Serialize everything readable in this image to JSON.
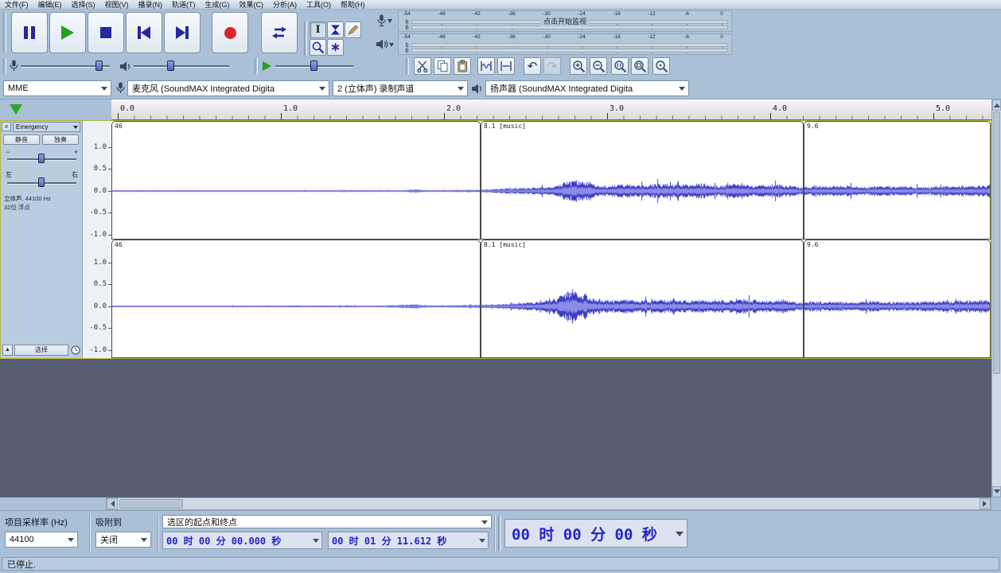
{
  "menu_bar": {
    "items": [
      "文件(F)",
      "编辑(E)",
      "选择(S)",
      "视图(V)",
      "播录(N)",
      "轨道(T)",
      "生成(G)",
      "效果(C)",
      "分析(A)",
      "工具(O)",
      "帮助(H)"
    ]
  },
  "icons": {
    "ibeam": "I",
    "multi": "∗",
    "undo": "↶",
    "redo": "↷",
    "close": "×",
    "collapse": "▲"
  },
  "meters": {
    "scale": [
      "-54",
      "-48",
      "-42",
      "-36",
      "-30",
      "-24",
      "-18",
      "-12",
      "-6",
      "0"
    ],
    "record_overlay": "点击开始监视",
    "left": "左",
    "right": "右"
  },
  "device_bar": {
    "host": "MME",
    "input": "麦克风 (SoundMAX Integrated Digita",
    "channels": "2 (立体声) 录制声道",
    "output": "扬声器 (SoundMAX Integrated Digita"
  },
  "timeline": {
    "labels": [
      "0.0",
      "1.0",
      "2.0",
      "3.0",
      "4.0",
      "5.0"
    ]
  },
  "track": {
    "title": "Emergency",
    "mute": "静音",
    "solo": "独奏",
    "gain_minus": "−",
    "gain_plus": "+",
    "pan_left": "左",
    "pan_right": "右",
    "info1": "立体声, 44100 Hz",
    "info2": "32位 浮点",
    "select": "选择",
    "scale": [
      "1.0",
      "0.5",
      "0.0",
      "-0.5",
      "-1.0"
    ],
    "clips": [
      {
        "label": "46"
      },
      {
        "label": "8.1 [music]"
      },
      {
        "label": "9.6"
      }
    ]
  },
  "waveform": {
    "color": "#3b3bc4",
    "rms_color": "#8c8ce8",
    "ch1": [
      [
        0,
        0.012
      ],
      [
        0.1,
        0.015
      ],
      [
        0.2,
        0.012
      ],
      [
        0.28,
        0.018
      ],
      [
        0.33,
        0.012
      ],
      [
        0.345,
        0.04
      ],
      [
        0.36,
        0.015
      ],
      [
        0.4,
        0.025
      ],
      [
        0.42,
        0.03
      ],
      [
        0.44,
        0.05
      ],
      [
        0.47,
        0.07
      ],
      [
        0.5,
        0.1
      ],
      [
        0.515,
        0.2
      ],
      [
        0.53,
        0.26
      ],
      [
        0.545,
        0.18
      ],
      [
        0.56,
        0.12
      ],
      [
        0.58,
        0.16
      ],
      [
        0.6,
        0.13
      ],
      [
        0.62,
        0.17
      ],
      [
        0.645,
        0.14
      ],
      [
        0.67,
        0.18
      ],
      [
        0.69,
        0.13
      ],
      [
        0.71,
        0.17
      ],
      [
        0.73,
        0.12
      ],
      [
        0.75,
        0.16
      ],
      [
        0.77,
        0.13
      ],
      [
        0.785,
        0.1
      ],
      [
        0.8,
        0.11
      ],
      [
        0.83,
        0.13
      ],
      [
        0.86,
        0.1
      ],
      [
        0.89,
        0.12
      ],
      [
        0.92,
        0.09
      ],
      [
        0.95,
        0.12
      ],
      [
        0.98,
        0.13
      ],
      [
        1,
        0.14
      ]
    ],
    "ch2": [
      [
        0,
        0.012
      ],
      [
        0.12,
        0.015
      ],
      [
        0.25,
        0.02
      ],
      [
        0.3,
        0.015
      ],
      [
        0.345,
        0.05
      ],
      [
        0.36,
        0.02
      ],
      [
        0.4,
        0.03
      ],
      [
        0.42,
        0.035
      ],
      [
        0.45,
        0.06
      ],
      [
        0.48,
        0.1
      ],
      [
        0.505,
        0.18
      ],
      [
        0.52,
        0.38
      ],
      [
        0.535,
        0.3
      ],
      [
        0.55,
        0.2
      ],
      [
        0.57,
        0.14
      ],
      [
        0.59,
        0.17
      ],
      [
        0.61,
        0.14
      ],
      [
        0.64,
        0.16
      ],
      [
        0.66,
        0.13
      ],
      [
        0.68,
        0.16
      ],
      [
        0.7,
        0.14
      ],
      [
        0.72,
        0.17
      ],
      [
        0.74,
        0.13
      ],
      [
        0.76,
        0.15
      ],
      [
        0.785,
        0.1
      ],
      [
        0.81,
        0.12
      ],
      [
        0.84,
        0.1
      ],
      [
        0.87,
        0.13
      ],
      [
        0.9,
        0.1
      ],
      [
        0.93,
        0.12
      ],
      [
        0.96,
        0.14
      ],
      [
        1,
        0.15
      ]
    ]
  },
  "selection_bar": {
    "rate_label": "项目采样率 (Hz)",
    "rate_value": "44100",
    "snap_label": "吸附到",
    "snap_value": "关闭",
    "range_label": "选区的起点和终点",
    "start_value": "00 时 00 分 00.000 秒",
    "end_value": "00 时 01 分 11.612 秒"
  },
  "time_display": {
    "value": "00 时 00 分 00 秒"
  },
  "status_bar": {
    "text": "已停止."
  }
}
